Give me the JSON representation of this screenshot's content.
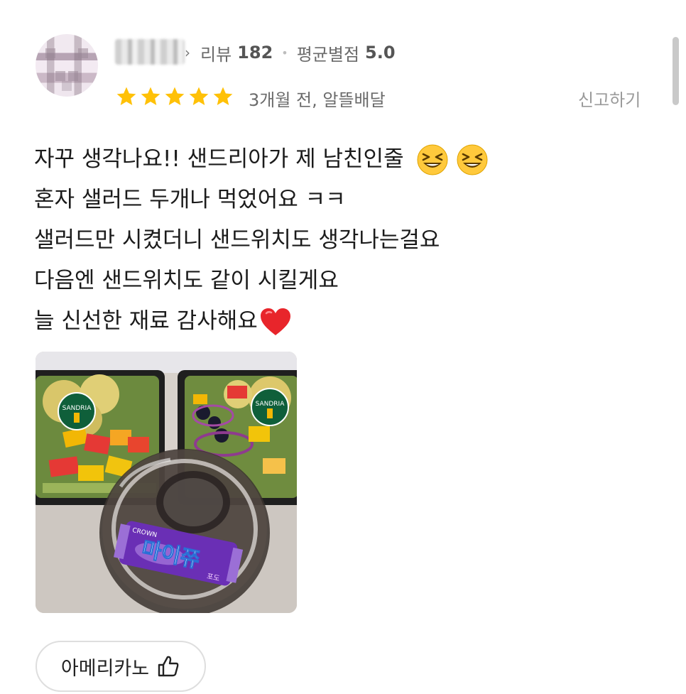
{
  "reviewer": {
    "review_count_label": "리뷰",
    "review_count": "182",
    "avg_rating_label": "평균별점",
    "avg_rating": "5.0"
  },
  "rating": {
    "stars": 5,
    "max": 5,
    "star_color": "#FFC107"
  },
  "meta": {
    "date_text": "3개월 전, 알뜰배달",
    "report_label": "신고하기"
  },
  "review": {
    "lines": [
      "자꾸 생각나요!! 샌드리아가 제 남친인줄",
      "혼자 샐러드 두개나 먹었어요 ㅋㅋ",
      "샐러드만 시켰더니 샌드위치도 생각나는걸요",
      "다음엔 샌드위치도 같이 시킬게요",
      "늘 신선한 재료 감사해요"
    ]
  },
  "photo": {
    "label_text": "SANDRIA",
    "candy_text": "마이쮸",
    "candy_small": "포도",
    "candy_brand": "CROWN"
  },
  "menu_tag": {
    "label": "아메리카노",
    "icon": "thumbs-up-icon"
  }
}
